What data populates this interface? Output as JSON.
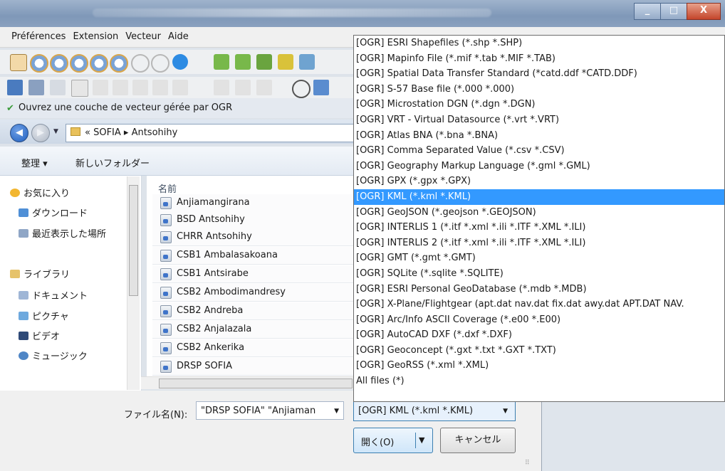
{
  "window": {
    "minimize_label": "_",
    "maximize_label": "□",
    "close_label": "X"
  },
  "menubar": {
    "items": [
      "Préférences",
      "Extension",
      "Vecteur",
      "Aide"
    ]
  },
  "dialog": {
    "title": "Ouvrez une couche de vecteur gérée par OGR",
    "breadcrumb": "« SOFIA ▸ Antsohihy",
    "organize_label": "整理 ▾",
    "new_folder_label": "新しいフォルダー",
    "column_name": "名前"
  },
  "nav_pane": {
    "favorites": "お気に入り",
    "downloads": "ダウンロード",
    "recent": "最近表示した場所",
    "libraries": "ライブラリ",
    "documents": "ドキュメント",
    "pictures": "ピクチャ",
    "videos": "ビデオ",
    "music": "ミュージック"
  },
  "files": [
    "Anjiamangirana",
    "BSD Antsohihy",
    "CHRR Antsohihy",
    "CSB1 Ambalasakoana",
    "CSB1 Antsirabe",
    "CSB2 Ambodimandresy",
    "CSB2 Andreba",
    "CSB2 Anjalazala",
    "CSB2 Ankerika",
    "DRSP SOFIA"
  ],
  "bottom": {
    "filename_label": "ファイル名(N):",
    "filename_value": "\"DRSP SOFIA\" \"Anjiaman",
    "filter_value": "[OGR] KML (*.kml *.KML)",
    "open_label": "開く(O)",
    "cancel_label": "キャンセル"
  },
  "filter_options": [
    "[OGR] ESRI Shapefiles (*.shp *.SHP)",
    "[OGR] Mapinfo File (*.mif *.tab *.MIF *.TAB)",
    "[OGR] Spatial Data Transfer Standard (*catd.ddf *CATD.DDF)",
    "[OGR] S-57 Base file (*.000 *.000)",
    "[OGR] Microstation DGN (*.dgn *.DGN)",
    "[OGR] VRT - Virtual Datasource  (*.vrt *.VRT)",
    "[OGR] Atlas BNA (*.bna *.BNA)",
    "[OGR] Comma Separated Value (*.csv *.CSV)",
    "[OGR] Geography Markup Language (*.gml *.GML)",
    "[OGR] GPX (*.gpx *.GPX)",
    "[OGR] KML (*.kml *.KML)",
    "[OGR] GeoJSON (*.geojson *.GEOJSON)",
    "[OGR] INTERLIS 1 (*.itf *.xml *.ili *.ITF *.XML *.ILI)",
    "[OGR] INTERLIS 2 (*.itf *.xml *.ili *.ITF *.XML *.ILI)",
    "[OGR] GMT (*.gmt *.GMT)",
    "[OGR] SQLite (*.sqlite *.SQLITE)",
    "[OGR] ESRI Personal GeoDatabase (*.mdb *.MDB)",
    "[OGR] X-Plane/Flightgear (apt.dat nav.dat fix.dat awy.dat APT.DAT NAV.",
    "[OGR] Arc/Info ASCII Coverage (*.e00 *.E00)",
    "[OGR] AutoCAD DXF (*.dxf *.DXF)",
    "[OGR] Geoconcept (*.gxt *.txt *.GXT *.TXT)",
    "[OGR] GeoRSS (*.xml *.XML)",
    "All files (*)"
  ],
  "selected_filter_index": 10,
  "colors": {
    "selection": "#3399ff",
    "accent_border": "#3c7fb1"
  }
}
